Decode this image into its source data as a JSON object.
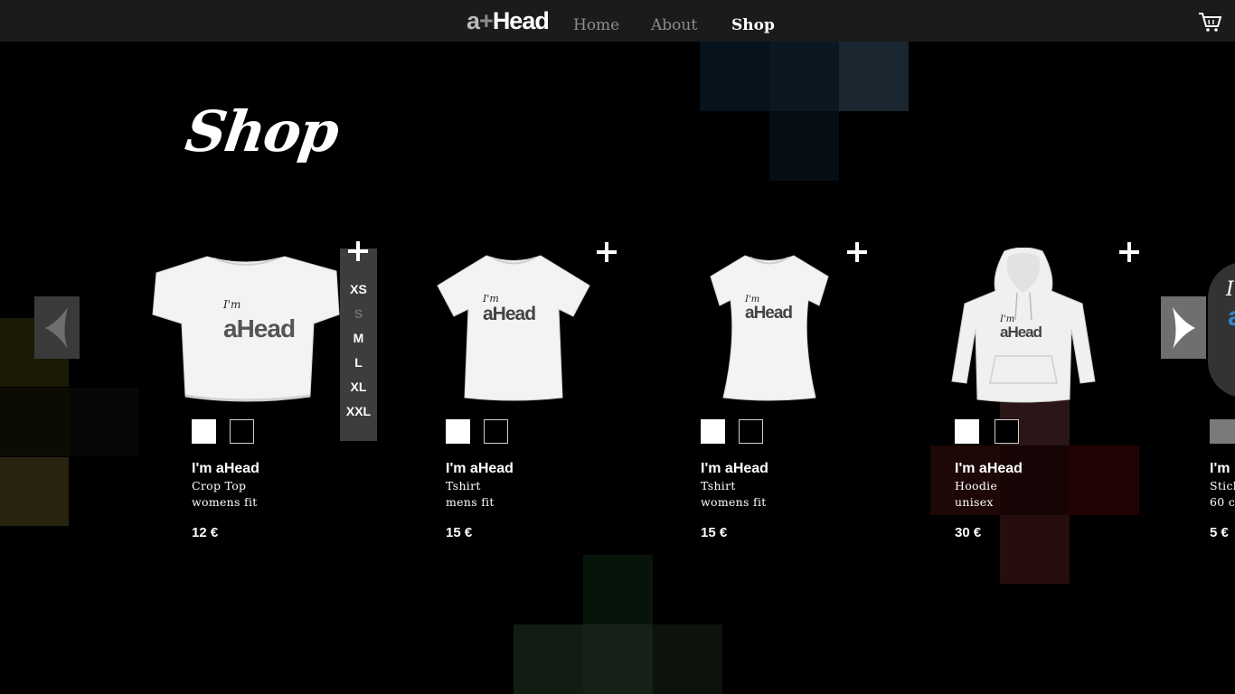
{
  "brand": {
    "logo_a": "a",
    "logo_plus": "+",
    "logo_rest": "Head"
  },
  "nav": [
    {
      "label": "Home",
      "active": false
    },
    {
      "label": "About",
      "active": false
    },
    {
      "label": "Shop",
      "active": true
    }
  ],
  "page": {
    "title": "Shop"
  },
  "sizes": [
    {
      "label": "XS",
      "available": true
    },
    {
      "label": "S",
      "available": false
    },
    {
      "label": "M",
      "available": true
    },
    {
      "label": "L",
      "available": true
    },
    {
      "label": "XL",
      "available": true
    },
    {
      "label": "XXL",
      "available": true
    }
  ],
  "products": [
    {
      "name": "I'm aHead",
      "type": "Crop Top",
      "fit": "womens fit",
      "price": "12 €",
      "print_im": "I'm",
      "print_brand": "aHead"
    },
    {
      "name": "I'm aHead",
      "type": "Tshirt",
      "fit": "mens fit",
      "price": "15 €",
      "print_im": "I'm",
      "print_brand": "aHead"
    },
    {
      "name": "I'm aHead",
      "type": "Tshirt",
      "fit": "womens fit",
      "price": "15 €",
      "print_im": "I'm",
      "print_brand": "aHead"
    },
    {
      "name": "I'm aHead",
      "type": "Hoodie",
      "fit": "unisex",
      "price": "30 €",
      "print_im": "I'm",
      "print_brand": "aHead"
    },
    {
      "name": "I'm",
      "type": "Stick",
      "fit": "60 c",
      "price": "5 €"
    }
  ],
  "icons": {
    "cart": "cart-icon",
    "prev": "chevron-left-icon",
    "next": "chevron-right-icon",
    "add": "plus-icon"
  },
  "colors": {
    "topbar": "#1b1b1b",
    "background": "#000000",
    "accent_blue": "#2f86c8",
    "inactive_nav": "#8c8c8c"
  }
}
